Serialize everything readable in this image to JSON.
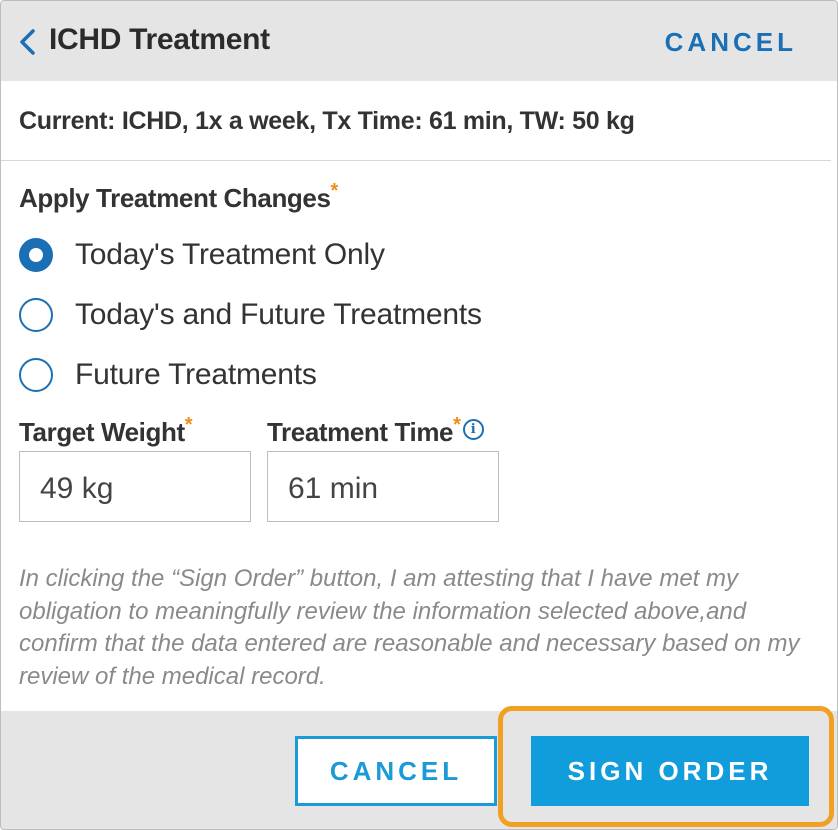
{
  "header": {
    "title": "ICHD Treatment",
    "cancel_label": "CANCEL"
  },
  "current_summary": "Current: ICHD, 1x a week, Tx Time: 61 min, TW: 50 kg",
  "apply_changes": {
    "label": "Apply Treatment Changes",
    "required_mark": "*",
    "options": [
      {
        "label": "Today's Treatment Only",
        "selected": true
      },
      {
        "label": "Today's and Future Treatments",
        "selected": false
      },
      {
        "label": "Future Treatments",
        "selected": false
      }
    ]
  },
  "fields": {
    "target_weight": {
      "label": "Target Weight",
      "required_mark": "*",
      "value": "49 kg"
    },
    "treatment_time": {
      "label": "Treatment Time",
      "required_mark": "*",
      "info": "i",
      "value": "61 min"
    }
  },
  "attestation": "In clicking the “Sign Order” button, I am attesting that I have met my obligation to meaningfully review the information selected above,and confirm that the data entered are reasonable and necessary based on my review of the medical record.",
  "footer": {
    "cancel_label": "CANCEL",
    "sign_label": "SIGN ORDER"
  },
  "colors": {
    "accent_blue": "#1a6fb5",
    "button_blue": "#119ddc",
    "required_orange": "#f08c1a",
    "highlight_orange": "#f0a023"
  },
  "icons": [
    "chevron-left-icon",
    "info-icon"
  ]
}
